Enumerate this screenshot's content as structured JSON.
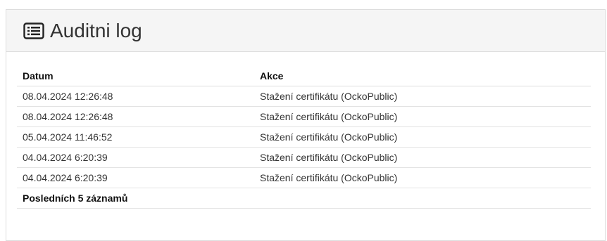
{
  "panel": {
    "title": "Auditni log",
    "icon": "list-alt-icon"
  },
  "table": {
    "columns": [
      "Datum",
      "Akce"
    ],
    "rows": [
      {
        "datum": "08.04.2024 12:26:48",
        "akce": "Stažení certifikátu (OckoPublic)"
      },
      {
        "datum": "08.04.2024 12:26:48",
        "akce": "Stažení certifikátu (OckoPublic)"
      },
      {
        "datum": "05.04.2024 11:46:52",
        "akce": "Stažení certifikátu (OckoPublic)"
      },
      {
        "datum": "04.04.2024 6:20:39",
        "akce": "Stažení certifikátu (OckoPublic)"
      },
      {
        "datum": "04.04.2024 6:20:39",
        "akce": "Stažení certifikátu (OckoPublic)"
      }
    ],
    "footer": "Posledních 5 záznamů"
  }
}
